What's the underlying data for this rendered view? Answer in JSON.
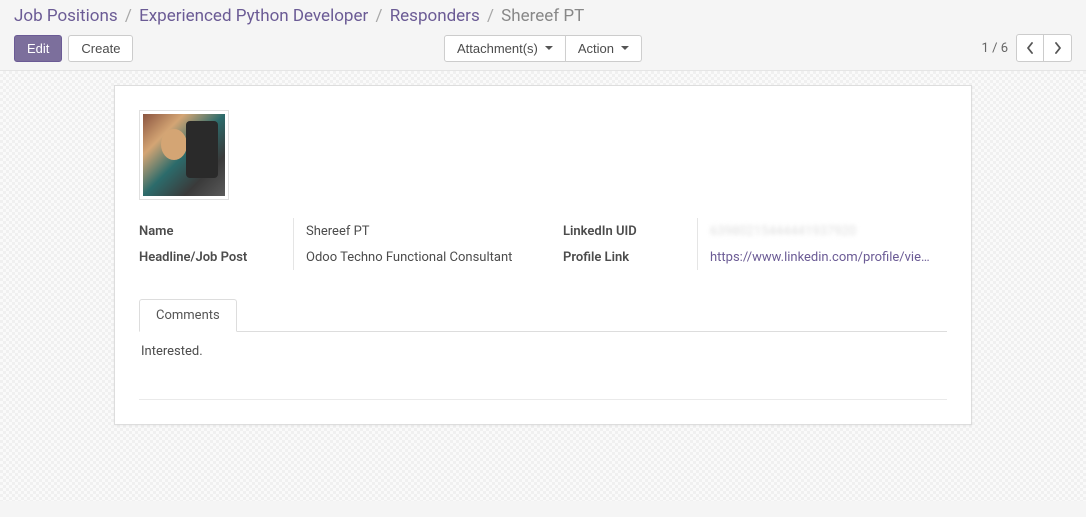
{
  "breadcrumb": {
    "items": [
      "Job Positions",
      "Experienced Python Developer",
      "Responders"
    ],
    "current": "Shereef PT"
  },
  "toolbar": {
    "edit_label": "Edit",
    "create_label": "Create",
    "attachments_label": "Attachment(s)",
    "action_label": "Action"
  },
  "pager": {
    "current": "1",
    "sep": "/",
    "total": "6"
  },
  "record": {
    "name_label": "Name",
    "name_value": "Shereef PT",
    "headline_label": "Headline/Job Post",
    "headline_value": "Odoo Techno Functional Consultant",
    "linkedin_uid_label": "LinkedIn UID",
    "linkedin_uid_value": "63980215444441937920",
    "profile_link_label": "Profile Link",
    "profile_link_text": "https://www.linkedin.com/profile/vie…"
  },
  "tabs": {
    "comments_label": "Comments"
  },
  "comments": {
    "text": "Interested."
  }
}
